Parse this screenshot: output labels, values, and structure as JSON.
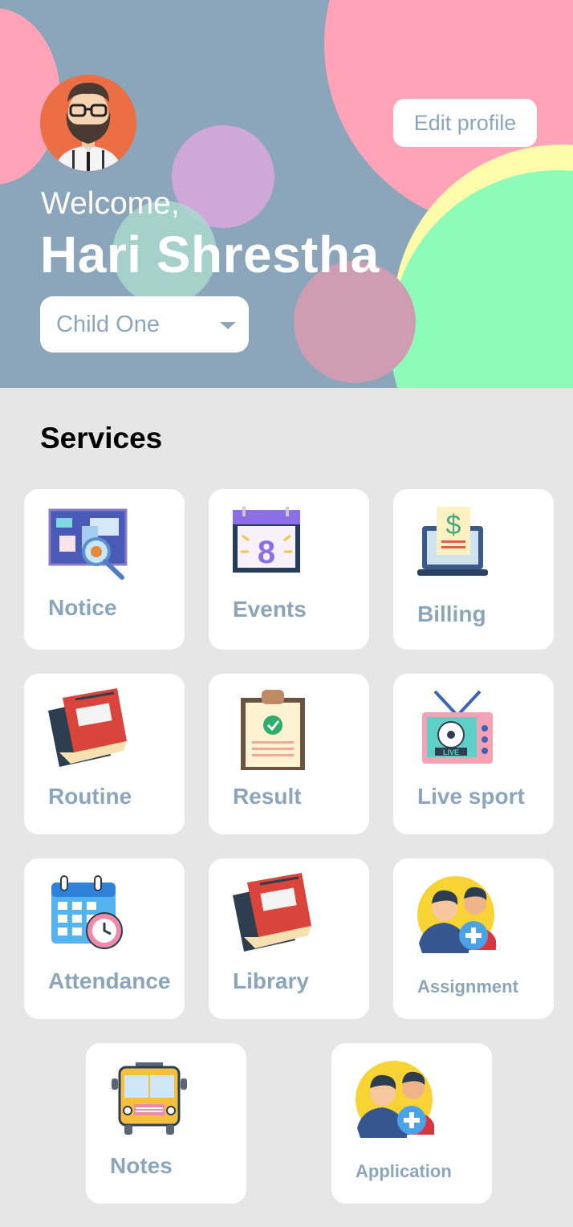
{
  "header": {
    "welcome": "Welcome,",
    "user_name": "Hari Shrestha",
    "edit_profile_label": "Edit profile",
    "child_select": {
      "selected": "Child One"
    },
    "colors": {
      "background": "#8ba5bb",
      "pink": "#ffa3b8",
      "purple": "#cfa8d9",
      "yellow": "#fdfcaa",
      "green": "#8dfcb8"
    }
  },
  "services": {
    "title": "Services",
    "items": [
      {
        "label": "Notice",
        "icon": "notice-board-icon"
      },
      {
        "label": "Events",
        "icon": "calendar-event-icon"
      },
      {
        "label": "Billing",
        "icon": "laptop-bill-icon"
      },
      {
        "label": "Routine",
        "icon": "book-icon"
      },
      {
        "label": "Result",
        "icon": "clipboard-result-icon"
      },
      {
        "label": "Live sport",
        "icon": "tv-live-icon"
      },
      {
        "label": "Attendance",
        "icon": "calendar-clock-icon"
      },
      {
        "label": "Library",
        "icon": "book-icon"
      },
      {
        "label": "Assignment",
        "icon": "people-add-icon"
      },
      {
        "label": "Notes",
        "icon": "bus-icon"
      },
      {
        "label": "Application",
        "icon": "people-add-icon"
      }
    ],
    "accent_color": "#8ba5bb"
  }
}
